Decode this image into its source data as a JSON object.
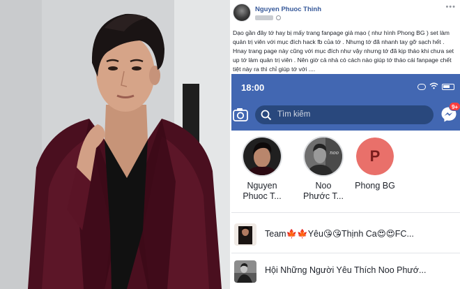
{
  "post": {
    "author_name": "Nguyen Phuoc Thinh",
    "body": "Dạo gần đây tớ hay bị mấy trang fanpage giả mạo ( như hình Phong BG ) set làm quản trị viên với mục đích hack fb của tớ . Nhưng tớ đã nhanh tay gỡ sạch hết . Hnay trang page này cũng với mục đích như vậy nhưng tớ đã kịp tháo khi chưa set up tớ làm quản trị viên . Nên giờ cả nhà có cách nào giúp tớ tháo cái fanpage chết tiệt này ra thì chỉ giúp tớ với ...."
  },
  "phone": {
    "time": "18:00",
    "search_placeholder": "Tìm kiếm",
    "messenger_badge": "9+",
    "suggestions": [
      {
        "line1": "Nguyen",
        "line2": "Phuoc T..."
      },
      {
        "line1": "Noo",
        "line2": "Phước T..."
      },
      {
        "line1": "Phong BG",
        "line2": "",
        "initial": "P"
      }
    ],
    "results": [
      {
        "text": "Team🍁🍁Yêu😘😘Thịnh Ca😍😍FC..."
      },
      {
        "text": "Hội Những Người Yêu Thích Noo Phướ..."
      }
    ]
  },
  "colors": {
    "fb_blue": "#4267b2",
    "search_bg": "#29487d",
    "author_link": "#365899",
    "badge_red": "#fa3e3e",
    "phong_avatar": "#e9706a"
  },
  "icons": [
    "camera-icon",
    "search-icon",
    "messenger-icon",
    "globe-icon",
    "wifi-icon",
    "battery-icon",
    "options-icon"
  ]
}
